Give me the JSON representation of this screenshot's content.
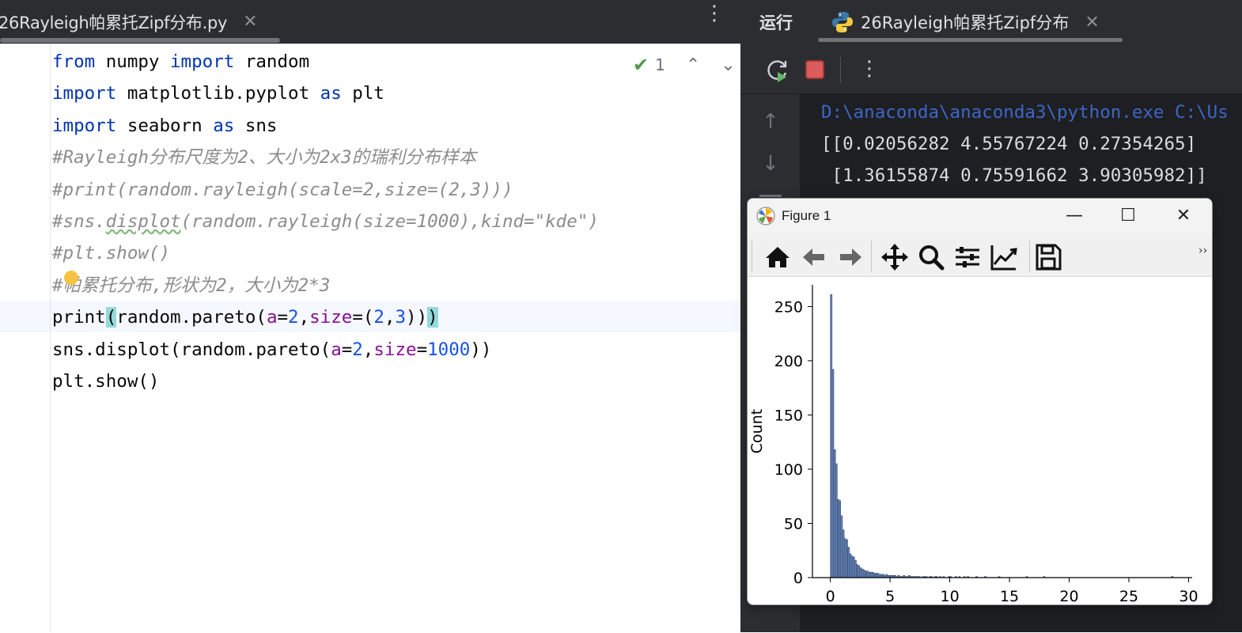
{
  "editor": {
    "tab_title": "26Rayleigh帕累托Zipf分布.py",
    "tab_close": "✕",
    "more": "⋮",
    "inspection": {
      "count": "1",
      "ok_icon": "check-icon"
    },
    "lines": [
      {
        "parts": [
          {
            "t": "from",
            "c": "kw"
          },
          {
            "t": " numpy "
          },
          {
            "t": "import",
            "c": "kw"
          },
          {
            "t": " random"
          }
        ]
      },
      {
        "parts": [
          {
            "t": "import",
            "c": "kw"
          },
          {
            "t": " matplotlib.pyplot "
          },
          {
            "t": "as",
            "c": "kw"
          },
          {
            "t": " plt"
          }
        ]
      },
      {
        "parts": [
          {
            "t": "import",
            "c": "kw"
          },
          {
            "t": " seaborn "
          },
          {
            "t": "as",
            "c": "kw"
          },
          {
            "t": " sns"
          }
        ]
      },
      {
        "parts": [
          {
            "t": "#Rayleigh分布尺度为2、大小为2x3的瑞利分布样本",
            "c": "cmt"
          }
        ]
      },
      {
        "parts": [
          {
            "t": "#print(random.rayleigh(scale=2,size=(2,3)))",
            "c": "cmt"
          }
        ]
      },
      {
        "parts": [
          {
            "t": "#sns.",
            "c": "cmt"
          },
          {
            "t": "displot",
            "c": "cmt wavy"
          },
          {
            "t": "(random.rayleigh(size=1000),kind=\"kde\")",
            "c": "cmt"
          }
        ]
      },
      {
        "parts": [
          {
            "t": "#plt.show()",
            "c": "cmt"
          }
        ]
      },
      {
        "parts": [
          {
            "t": "#帕累托分布,形状为2，大小为2*3",
            "c": "cmt"
          }
        ]
      },
      {
        "parts": [
          {
            "t": "print"
          },
          {
            "t": "(",
            "c": "brace-hl"
          },
          {
            "t": "random.pareto("
          },
          {
            "t": "a",
            "c": "param"
          },
          {
            "t": "="
          },
          {
            "t": "2",
            "c": "num"
          },
          {
            "t": ","
          },
          {
            "t": "size",
            "c": "param"
          },
          {
            "t": "=("
          },
          {
            "t": "2",
            "c": "num"
          },
          {
            "t": ","
          },
          {
            "t": "3",
            "c": "num"
          },
          {
            "t": "))"
          },
          {
            "t": ")",
            "c": "brace-hl"
          }
        ]
      },
      {
        "parts": [
          {
            "t": "sns.displot(random.pareto("
          },
          {
            "t": "a",
            "c": "param"
          },
          {
            "t": "="
          },
          {
            "t": "2",
            "c": "num"
          },
          {
            "t": ","
          },
          {
            "t": "size",
            "c": "param"
          },
          {
            "t": "="
          },
          {
            "t": "1000",
            "c": "num"
          },
          {
            "t": "))"
          }
        ]
      },
      {
        "parts": [
          {
            "t": "plt.show()"
          }
        ]
      }
    ]
  },
  "run": {
    "title": "运行",
    "tab_title": "26Rayleigh帕累托Zipf分布",
    "tab_close": "✕",
    "more": "⋮",
    "console": [
      "D:\\anaconda\\anaconda3\\python.exe C:\\Us",
      "[[0.02056282 4.55767224 0.27354265]",
      " [1.36155874 0.75591662 3.90305982]]"
    ]
  },
  "figure": {
    "title": "Figure 1",
    "minimize": "—",
    "maximize": "☐",
    "close": "✕",
    "overflow": "››",
    "toolbar_icons": [
      "home-icon",
      "back-icon",
      "forward-icon",
      "pan-icon",
      "zoom-icon",
      "subplots-icon",
      "customize-icon",
      "save-icon"
    ]
  },
  "chart_data": {
    "type": "bar",
    "title": "",
    "xlabel": "",
    "ylabel": "Count",
    "xlim": [
      -1.5,
      30.3
    ],
    "ylim": [
      0,
      270
    ],
    "xticks": [
      0,
      5,
      10,
      15,
      20,
      25,
      30
    ],
    "yticks": [
      0,
      50,
      100,
      150,
      200,
      250
    ],
    "bar_color": "#4c72b0",
    "bin_width": 0.145,
    "bin_start": 0.0,
    "counts": [
      261,
      192,
      118,
      105,
      72,
      71,
      57,
      44,
      36,
      35,
      28,
      22,
      20,
      19,
      16,
      12,
      11,
      9,
      8,
      7,
      6,
      6,
      5,
      5,
      5,
      4,
      4,
      4,
      3,
      3,
      3,
      2,
      3,
      2,
      2,
      2,
      2,
      2,
      1,
      2,
      1,
      1,
      2,
      1,
      1,
      2,
      1,
      1,
      1,
      1,
      1,
      1,
      0,
      1,
      1,
      1,
      0,
      1,
      1,
      0,
      1,
      1,
      0,
      1,
      0,
      1,
      0,
      0,
      1,
      1,
      0,
      0,
      1,
      0,
      1,
      0,
      0,
      1,
      0,
      1,
      0,
      0,
      0,
      0,
      1,
      0,
      0,
      0,
      0,
      1,
      0,
      0,
      0,
      0,
      0,
      0,
      0,
      1,
      0,
      0,
      0,
      0,
      0,
      0,
      0,
      0,
      0,
      0,
      0,
      0,
      0,
      0,
      0,
      1,
      0,
      0,
      0,
      0,
      0,
      0,
      0,
      0,
      0,
      1,
      0,
      0,
      0,
      0,
      0,
      0,
      0,
      0,
      0,
      0,
      0,
      0,
      0,
      0,
      0,
      0,
      0,
      0,
      0,
      0,
      0,
      0,
      0,
      0,
      0,
      0,
      0,
      0,
      0,
      0,
      0,
      0,
      0,
      0,
      0,
      0,
      0,
      0,
      0,
      0,
      0,
      0,
      0,
      0,
      0,
      0,
      0,
      0,
      0,
      0,
      0,
      0,
      0,
      0,
      0,
      0,
      0,
      0,
      0,
      0,
      0,
      0,
      0,
      0,
      0,
      0,
      0,
      0,
      0,
      0,
      0,
      0,
      0,
      1
    ]
  }
}
